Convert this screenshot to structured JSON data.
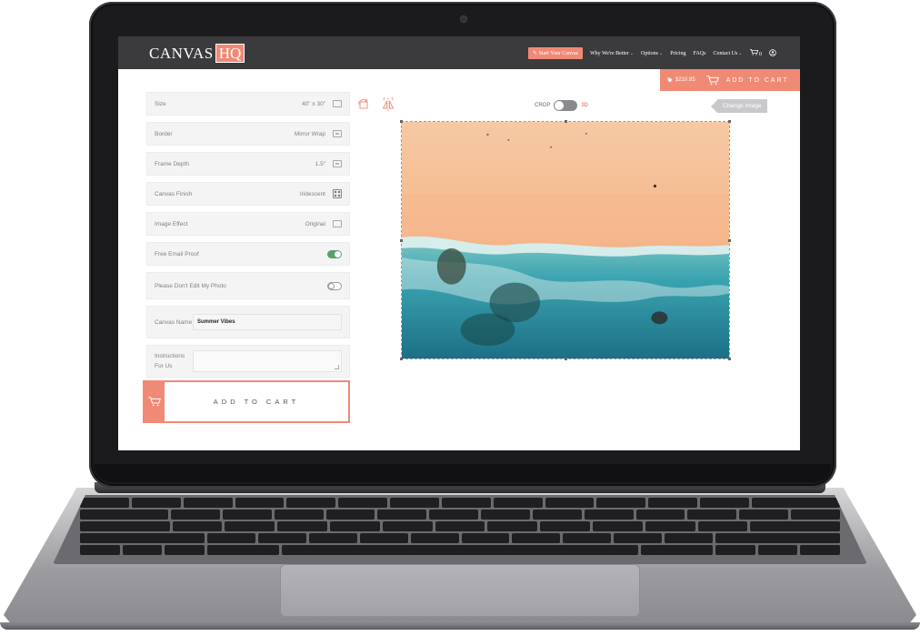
{
  "site": {
    "logo_text": "CANVAS",
    "logo_box": "HQ"
  },
  "nav": {
    "cta": "Start Your Canvas",
    "items": [
      {
        "label": "Why We're Better",
        "dropdown": true
      },
      {
        "label": "Options",
        "dropdown": true
      },
      {
        "label": "Pricing",
        "dropdown": false
      },
      {
        "label": "FAQs",
        "dropdown": false
      },
      {
        "label": "Contact Us",
        "dropdown": true
      }
    ],
    "cart_count": "0"
  },
  "cart_bar": {
    "price": "$210.95",
    "label": "ADD TO CART"
  },
  "options": {
    "size": {
      "label": "Size",
      "value": "40\" x 30\""
    },
    "border": {
      "label": "Border",
      "value": "Mirror Wrap"
    },
    "frame_depth": {
      "label": "Frame Depth",
      "value": "1.5\""
    },
    "canvas_finish": {
      "label": "Canvas Finish",
      "value": "Iridescent"
    },
    "image_effect": {
      "label": "Image Effect",
      "value": "Original"
    },
    "email_proof": {
      "label": "Free Email Proof",
      "enabled": true
    },
    "dont_edit": {
      "label": "Please Don't Edit My Photo",
      "enabled": false
    },
    "canvas_name": {
      "label": "Canvas Name",
      "value": "Summer Vibes"
    },
    "instructions": {
      "label": "Instructions For Us",
      "value": ""
    }
  },
  "add_to_cart": {
    "label": "ADD TO CART"
  },
  "editor": {
    "crop_label": "CROP",
    "mode_3d_label": "3D",
    "change_image": "Change Image"
  },
  "colors": {
    "accent": "#f08a75",
    "nav_bg": "#3b3b3d",
    "toggle_on": "#55a06c"
  },
  "icons": {
    "rotate": "rotate-icon",
    "flip": "flip-icon",
    "cart": "cart-icon",
    "account": "user-icon",
    "tag": "price-tag-icon"
  }
}
